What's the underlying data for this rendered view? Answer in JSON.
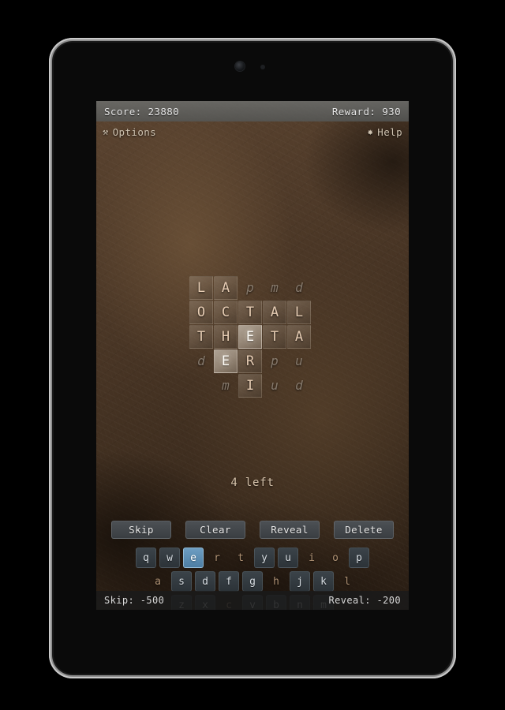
{
  "device": {
    "camera_icon": "camera-lens",
    "sensor_icon": "proximity-sensor"
  },
  "score_bar": {
    "score_label": "Score: 23880",
    "reward_label": "Reward: 930"
  },
  "menu_bar": {
    "options_glyph": "⚒",
    "options_label": "Options",
    "help_glyph": "✸",
    "help_label": "Help"
  },
  "grid": {
    "columns": 5,
    "rows": 5,
    "cells": [
      {
        "letter": "L",
        "state": "tile"
      },
      {
        "letter": "A",
        "state": "tile"
      },
      {
        "letter": "p",
        "state": "ghost"
      },
      {
        "letter": "m",
        "state": "ghost"
      },
      {
        "letter": "d",
        "state": "ghost"
      },
      {
        "letter": "O",
        "state": "tile"
      },
      {
        "letter": "C",
        "state": "tile"
      },
      {
        "letter": "T",
        "state": "tile"
      },
      {
        "letter": "A",
        "state": "tile"
      },
      {
        "letter": "L",
        "state": "tile"
      },
      {
        "letter": "T",
        "state": "tile"
      },
      {
        "letter": "H",
        "state": "tile"
      },
      {
        "letter": "E",
        "state": "hot"
      },
      {
        "letter": "T",
        "state": "tile"
      },
      {
        "letter": "A",
        "state": "tile"
      },
      {
        "letter": "d",
        "state": "ghost"
      },
      {
        "letter": "E",
        "state": "hot"
      },
      {
        "letter": "R",
        "state": "tile"
      },
      {
        "letter": "p",
        "state": "ghost"
      },
      {
        "letter": "u",
        "state": "ghost"
      },
      {
        "letter": "",
        "state": "blank"
      },
      {
        "letter": "m",
        "state": "ghost"
      },
      {
        "letter": "I",
        "state": "tile"
      },
      {
        "letter": "u",
        "state": "ghost"
      },
      {
        "letter": "d",
        "state": "ghost"
      }
    ]
  },
  "remaining": {
    "text": "4 left"
  },
  "actions": [
    {
      "label": "Skip"
    },
    {
      "label": "Clear"
    },
    {
      "label": "Reveal"
    },
    {
      "label": "Delete"
    }
  ],
  "keyboard": {
    "rows": [
      [
        {
          "key": "q",
          "state": "normal"
        },
        {
          "key": "w",
          "state": "normal"
        },
        {
          "key": "e",
          "state": "selected"
        },
        {
          "key": "r",
          "state": "used"
        },
        {
          "key": "t",
          "state": "used"
        },
        {
          "key": "y",
          "state": "normal"
        },
        {
          "key": "u",
          "state": "normal"
        },
        {
          "key": "i",
          "state": "used"
        },
        {
          "key": "o",
          "state": "used"
        },
        {
          "key": "p",
          "state": "normal"
        }
      ],
      [
        {
          "key": "a",
          "state": "used"
        },
        {
          "key": "s",
          "state": "normal"
        },
        {
          "key": "d",
          "state": "normal"
        },
        {
          "key": "f",
          "state": "normal"
        },
        {
          "key": "g",
          "state": "normal"
        },
        {
          "key": "h",
          "state": "used"
        },
        {
          "key": "j",
          "state": "normal"
        },
        {
          "key": "k",
          "state": "normal"
        },
        {
          "key": "l",
          "state": "used"
        }
      ],
      [
        {
          "key": "z",
          "state": "normal"
        },
        {
          "key": "x",
          "state": "normal"
        },
        {
          "key": "c",
          "state": "used"
        },
        {
          "key": "v",
          "state": "normal"
        },
        {
          "key": "b",
          "state": "normal"
        },
        {
          "key": "n",
          "state": "normal"
        },
        {
          "key": "m",
          "state": "normal"
        }
      ]
    ]
  },
  "status_bar": {
    "skip_cost": "Skip: -500",
    "reveal_cost": "Reveal: -200"
  }
}
